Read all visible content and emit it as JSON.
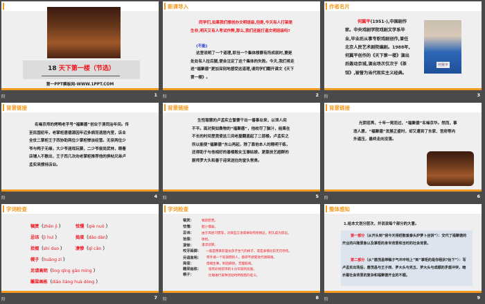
{
  "label_text": "阶",
  "colors": {
    "accent": "#f39a1e",
    "red": "#f0141e",
    "background": "#4a4a4a"
  },
  "slides": [
    {
      "number": "1",
      "title_num": "18",
      "title": "天下第一楼（节选）",
      "subtitle": "第一PPT模板网-WWW.1PPT.COM"
    },
    {
      "number": "2",
      "header": "新课导入",
      "question": "同学们,如果我们想创办文明班级,但是,今天有人打架是生非,明天又有人考试作弊,那么,我们还能打造文明班级吗?",
      "answer": "(不能)",
      "body": "这里说明了一个道理,即当一个集体想要有所成就时,要是处处有人拉后腿,便会注定了这个集体的失败。今天,我们将走进“福聚德”更加深刻地感受这道理,请同学们翻开课文《天下第一楼》。"
    },
    {
      "number": "3",
      "header": "作者名片",
      "name": "何冀平",
      "bio": "(1951-),中国剧作家。中央戏剧学院戏剧文学系毕业,毕业后从事专职戏剧创作,曾任北京人民艺术剧院编剧。1988年,何冀平创作的《天下第一楼》演出后轰动京城,演出场次仅次于《茶馆》,被誉为当代现实主义经典。",
      "nameplate": "何冀平"
    },
    {
      "number": "4",
      "header": "背景链接",
      "body": "名噪京师的烤鸭老字号“福聚德”创业于清同治年间。传至民国初年，老掌柜唐德源因年迈多病而退居内室，店业全仗二掌柜王子西协助两位少掌柜惨淡经营。无奈两位少爷与鸭子无缘，大少爷迷戏玩票，二少爷尝尚武林，眼看店铺入不敷出，王子西几次向老掌柜推荐他的换帖兄弟卢孟实来撑持店业。"
    },
    {
      "number": "5",
      "header": "背景链接",
      "body": "生性聪慧的卢孟实立誓要干出一番事业来，以泄人间不平。面对契如桑物的“福聚德”，他绞尽了脑汁，结果在不长的时间里竟使这三间老屋翻盖起了二层楼。卢孟实之所以能使“福聚德”东山再起，除了靠他本人的精明干练，还得助于与他相好的善楼殷女玉雏姑娘，更靠技艺超群的厨师罗大头和善于迎来送往的堂头常贵。"
    },
    {
      "number": "6",
      "header": "背景链接",
      "body": "光阴荏苒，十年一晃而过，“福聚德”名噪京华。然而，事违人愿，“福聚德”发展正盛时，却又遭到了东家、官府等内外逼压，最终走向没落。"
    },
    {
      "number": "7",
      "header": "字词检查",
      "items": [
        {
          "word": "犒赏",
          "pinyin": "zhēn jì"
        },
        {
          "word": "怯懦",
          "pinyin": "qiè nuò"
        },
        {
          "word": "忌讳",
          "pinyin": "jì huì"
        },
        {
          "word": "捣蛋",
          "pinyin": "dǎo dàn"
        },
        {
          "word": "拾掇",
          "pinyin": "shí duo"
        },
        {
          "word": "凄惨",
          "pinyin": "qī cǎn"
        },
        {
          "word": "幌子",
          "pinyin": "huǎng zi"
        },
        {
          "word": "另请高明",
          "pinyin": "lìng qǐng gāo míng"
        },
        {
          "word": "雕梁画栋",
          "pinyin": "diāo liáng huà dòng"
        }
      ]
    },
    {
      "number": "8",
      "header": "字词检查",
      "items": [
        {
          "term": "犒赏：",
          "def": "犒赏慰劳。"
        },
        {
          "term": "怯懦：",
          "def": "胆小懦弱。"
        },
        {
          "term": "忌讳：",
          "def": "由于风俗习惯等，对某些言语或举动有所顾忌，积久成为禁忌。"
        },
        {
          "term": "拾掇：",
          "def": "收拾。"
        },
        {
          "term": "凄惨：",
          "def": "凄凉悲惨。"
        },
        {
          "term": "咬牙跺脚：",
          "def": "一般是用来形容女孩子生气的样子，或是表情比较无可奈何。"
        },
        {
          "term": "另请高明：",
          "def": "另外请一个较高明的人，意即不想变动代谢辞谢。"
        },
        {
          "term": "捣蛋：",
          "def": "借端生事，制造麻烦，无理取闹。"
        },
        {
          "term": "雕梁画栋：",
          "def": "指有彩绘装饰的十分华丽的房屋。"
        },
        {
          "term": "幌子：",
          "def": "比喻进行某种活动时所假借的名义。"
        }
      ]
    },
    {
      "number": "9",
      "header": "整体感知",
      "intro": "1.给本文划分层次，并说说每个部分的大意。",
      "part1_label": "第一部分",
      "part1": "（从开头到“我今天得赶散羞秦头炉萝卜丝饼”）：交代了福聚德的开业的兴隆景象以及掌柜的身世背景和当时的社会背景。",
      "part2_label": "第二部分",
      "part2": "（从“唐茂昌带稿子气冲冲地上”到“掌柜的是你租宗?抬下”）：写卢孟实出场后，唐茂昌与王子西、罗大头与克五、罗大头与成顺的矛盾冲突，暗示着社会背景的复杂和福聚德开业的不顺。"
    }
  ]
}
